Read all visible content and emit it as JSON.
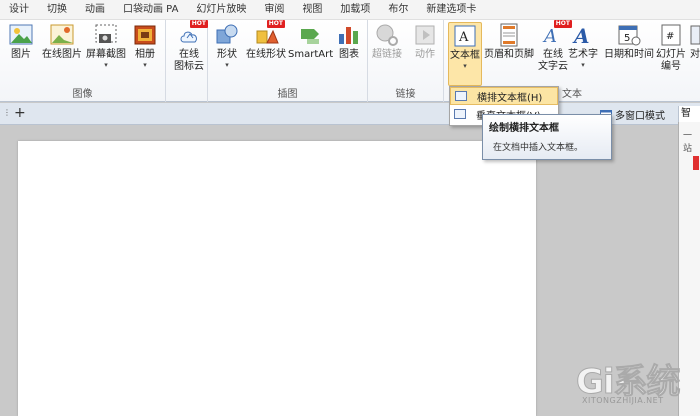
{
  "menu": {
    "tabs": [
      "设计",
      "切换",
      "动画",
      "口袋动画 PA",
      "幻灯片放映",
      "审阅",
      "视图",
      "加载项",
      "布尔",
      "新建选项卡"
    ]
  },
  "ribbon": {
    "hot": "HOT",
    "groups": {
      "image": "图像",
      "illustration": "插图",
      "link": "链接",
      "text": "文本"
    },
    "buttons": {
      "picture": "图片",
      "online_picture": "在线图片",
      "screenshot": "屏幕截图",
      "album": "相册",
      "online_icon": "在线\n图标云",
      "shapes": "形状",
      "online_shapes": "在线形状",
      "smartart": "SmartArt",
      "chart": "图表",
      "hyperlink": "超链接",
      "action": "动作",
      "textbox": "文本框",
      "header_footer": "页眉和页脚",
      "online_textcloud": "在线\n文字云",
      "wordart": "艺术字",
      "datetime": "日期和时间",
      "slide_number": "幻灯片\n编号",
      "object": "对"
    }
  },
  "toolbar": {
    "add": "+",
    "multi_window": "多窗口模式",
    "smart": "智能",
    "right_pane_text": "一站"
  },
  "dropdown": {
    "items": [
      "横排文本框(H)",
      "垂直文本框(V)"
    ]
  },
  "tooltip": {
    "title": "绘制横排文本框",
    "desc": "在文档中插入文本框。"
  },
  "watermark": {
    "brand": "Gi系统",
    "site": "XITONGZHIJIA.NET"
  }
}
